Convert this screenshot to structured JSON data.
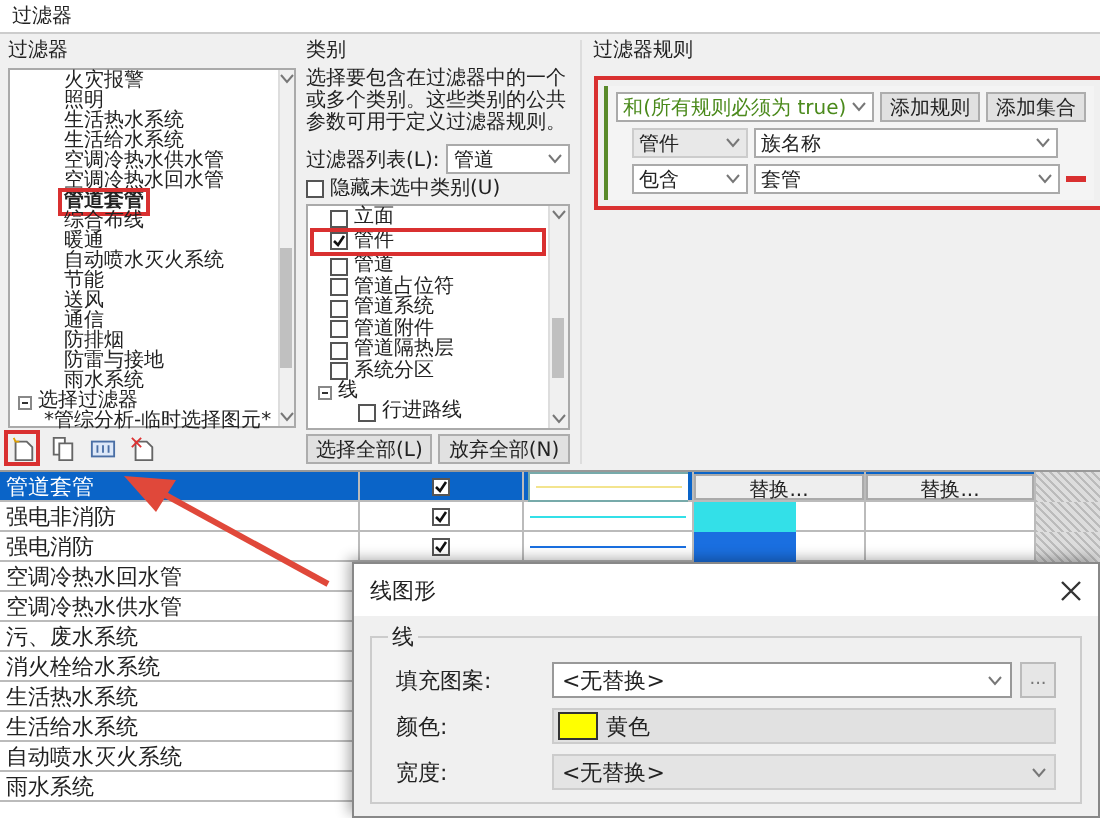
{
  "filters_dialog": {
    "title": "过滤器",
    "filters": {
      "label": "过滤器",
      "rule_filters": [
        {
          "label": "火灾报警",
          "selected": false
        },
        {
          "label": "照明",
          "selected": false
        },
        {
          "label": "生活热水系统",
          "selected": false
        },
        {
          "label": "生活给水系统",
          "selected": false
        },
        {
          "label": "空调冷热水供水管",
          "selected": false
        },
        {
          "label": "空调冷热水回水管",
          "selected": false
        },
        {
          "label": "管道套管",
          "selected": true
        },
        {
          "label": "综合布线",
          "selected": false
        },
        {
          "label": "暖通",
          "selected": false
        },
        {
          "label": "自动喷水灭火系统",
          "selected": false
        },
        {
          "label": "节能",
          "selected": false
        },
        {
          "label": "送风",
          "selected": false
        },
        {
          "label": "通信",
          "selected": false
        },
        {
          "label": "防排烟",
          "selected": false
        },
        {
          "label": "防雷与接地",
          "selected": false
        },
        {
          "label": "雨水系统",
          "selected": false
        }
      ],
      "selection_filters": {
        "label": "选择过滤器",
        "expanded": true,
        "children": [
          {
            "label": "*管综分析-临时选择图元*",
            "selected": false
          }
        ]
      },
      "toolbar": [
        {
          "kind": "new",
          "highlighted": true
        },
        {
          "kind": "copy",
          "highlighted": false
        },
        {
          "kind": "rename",
          "highlighted": false
        },
        {
          "kind": "delete",
          "highlighted": false
        }
      ]
    },
    "categories": {
      "label": "类别",
      "description": "选择要包含在过滤器中的一个或多个类别。这些类别的公共参数可用于定义过滤器规则。",
      "list_label": "过滤器列表(L):",
      "list_value": "管道",
      "hide_unchecked": {
        "label": "隐藏未选中类别(U)",
        "checked": false
      },
      "items": [
        {
          "label": "立面",
          "checked": false,
          "highlighted": false
        },
        {
          "label": "管件",
          "checked": true,
          "highlighted": true
        },
        {
          "label": "管道",
          "checked": false,
          "highlighted": false
        },
        {
          "label": "管道占位符",
          "checked": false,
          "highlighted": false
        },
        {
          "label": "管道系统",
          "checked": false,
          "highlighted": false
        },
        {
          "label": "管道附件",
          "checked": false,
          "highlighted": false
        },
        {
          "label": "管道隔热层",
          "checked": false,
          "highlighted": false
        },
        {
          "label": "系统分区",
          "checked": false,
          "highlighted": false
        }
      ],
      "groups": [
        {
          "label": "线",
          "expanded": true,
          "children": [
            {
              "label": "行进路线",
              "checked": false
            }
          ]
        }
      ],
      "buttons": [
        "选择全部(L)",
        "放弃全部(N)"
      ]
    },
    "rules": {
      "label": "过滤器规则",
      "operator": "和(所有规则必须为 true)",
      "buttons": [
        "添加规则",
        "添加集合"
      ],
      "rule": {
        "category": "管件",
        "parameter": "族名称",
        "condition": "包含",
        "value": "套管"
      }
    }
  },
  "table": {
    "rows": [
      {
        "name": "管道套管",
        "selected": true,
        "checked": true,
        "color": "#f3e48e",
        "swatch": false,
        "buttons": [
          "替换...",
          "替换..."
        ]
      },
      {
        "name": "强电非消防",
        "selected": false,
        "checked": true,
        "color": "#33e0e8",
        "swatch": true
      },
      {
        "name": "强电消防",
        "selected": false,
        "checked": true,
        "color": "#1a6fe0",
        "swatch": true
      },
      {
        "name": "空调冷热水回水管",
        "selected": false
      },
      {
        "name": "空调冷热水供水管",
        "selected": false
      },
      {
        "name": "污、废水系统",
        "selected": false
      },
      {
        "name": "消火栓给水系统",
        "selected": false
      },
      {
        "name": "生活热水系统",
        "selected": false
      },
      {
        "name": "生活给水系统",
        "selected": false
      },
      {
        "name": "自动喷水灭火系统",
        "selected": false
      },
      {
        "name": "雨水系统",
        "selected": false
      }
    ]
  },
  "line_graphics": {
    "title": "线图形",
    "group": "线",
    "fields": [
      {
        "kind": "dropdown",
        "label": "填充图案:",
        "value": "<无替换>",
        "disabled": false,
        "more_button": "..."
      },
      {
        "kind": "color",
        "label": "颜色:",
        "value": "黄色",
        "color": "#ffff00"
      },
      {
        "kind": "dropdown",
        "label": "宽度:",
        "value": "<无替换>",
        "disabled": true
      }
    ]
  }
}
